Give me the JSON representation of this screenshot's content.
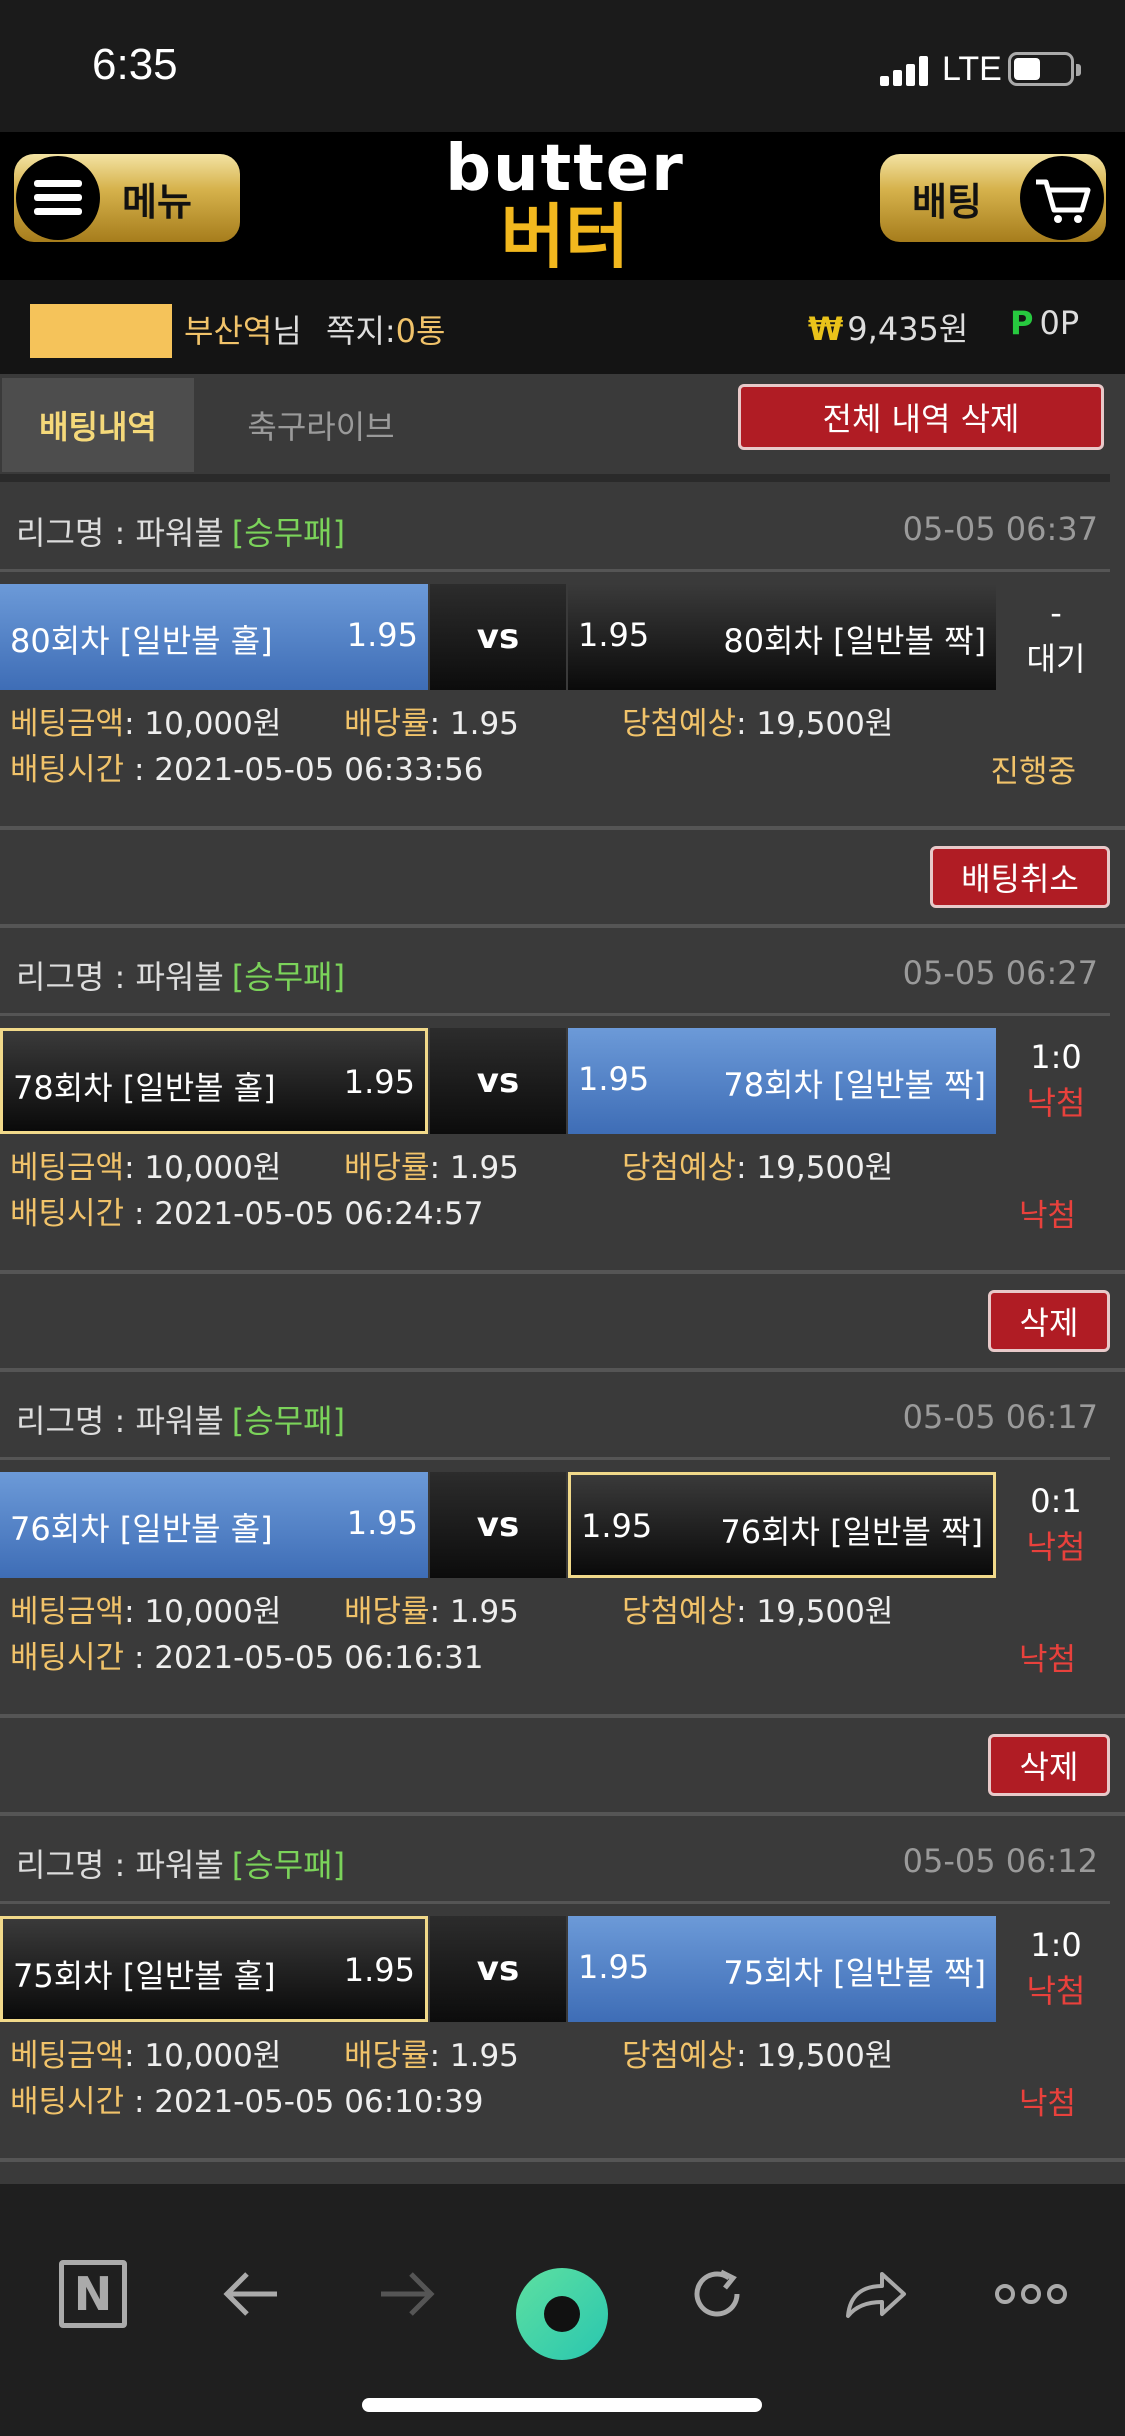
{
  "status_bar": {
    "time": "6:35",
    "network": "LTE"
  },
  "header": {
    "menu_label": "메뉴",
    "logo_en": "butter",
    "logo_ko": "버터",
    "bet_label": "배팅"
  },
  "user": {
    "name": "부산역",
    "suffix": "님",
    "memo_label": "쪽지:",
    "memo_count": "0통",
    "money_symbol": "₩",
    "money": "9,435원",
    "point_symbol": "P",
    "point": "0P"
  },
  "tabs": {
    "active": "배팅내역",
    "other": "축구라이브",
    "delete_all": "전체 내역 삭제"
  },
  "labels": {
    "league_prefix": "리그명 : ",
    "amount": "베팅금액",
    "odds": "배당률",
    "expected": "당첨예상",
    "time": "배팅시간",
    "vs": "vs"
  },
  "bets": [
    {
      "league": "파워볼",
      "tag": "[승무패]",
      "datetime": "05-05 06:37",
      "home": {
        "team": "80회차 [일반볼 홀]",
        "odds": "1.95"
      },
      "away": {
        "team": "80회차 [일반볼 짝]",
        "odds": "1.95"
      },
      "score": "-",
      "result": "대기",
      "amount": "10,000원",
      "bet_odds": "1.95",
      "expected": "19,500원",
      "bet_time": "2021-05-05 06:33:56",
      "status": "진행중"
    },
    {
      "league": "파워볼",
      "tag": "[승무패]",
      "datetime": "05-05 06:27",
      "home": {
        "team": "78회차 [일반볼 홀]",
        "odds": "1.95"
      },
      "away": {
        "team": "78회차 [일반볼 짝]",
        "odds": "1.95"
      },
      "score": "1:0",
      "result": "낙첨",
      "amount": "10,000원",
      "bet_odds": "1.95",
      "expected": "19,500원",
      "bet_time": "2021-05-05 06:24:57",
      "status": "낙첨"
    },
    {
      "league": "파워볼",
      "tag": "[승무패]",
      "datetime": "05-05 06:17",
      "home": {
        "team": "76회차 [일반볼 홀]",
        "odds": "1.95"
      },
      "away": {
        "team": "76회차 [일반볼 짝]",
        "odds": "1.95"
      },
      "score": "0:1",
      "result": "낙첨",
      "amount": "10,000원",
      "bet_odds": "1.95",
      "expected": "19,500원",
      "bet_time": "2021-05-05 06:16:31",
      "status": "낙첨"
    },
    {
      "league": "파워볼",
      "tag": "[승무패]",
      "datetime": "05-05 06:12",
      "home": {
        "team": "75회차 [일반볼 홀]",
        "odds": "1.95"
      },
      "away": {
        "team": "75회차 [일반볼 짝]",
        "odds": "1.95"
      },
      "score": "1:0",
      "result": "낙첨",
      "amount": "10,000원",
      "bet_odds": "1.95",
      "expected": "19,500원",
      "bet_time": "2021-05-05 06:10:39",
      "status": "낙첨"
    }
  ],
  "actions": {
    "cancel": "배팅취소",
    "delete": "삭제"
  },
  "browser": {
    "n_label": "N"
  }
}
